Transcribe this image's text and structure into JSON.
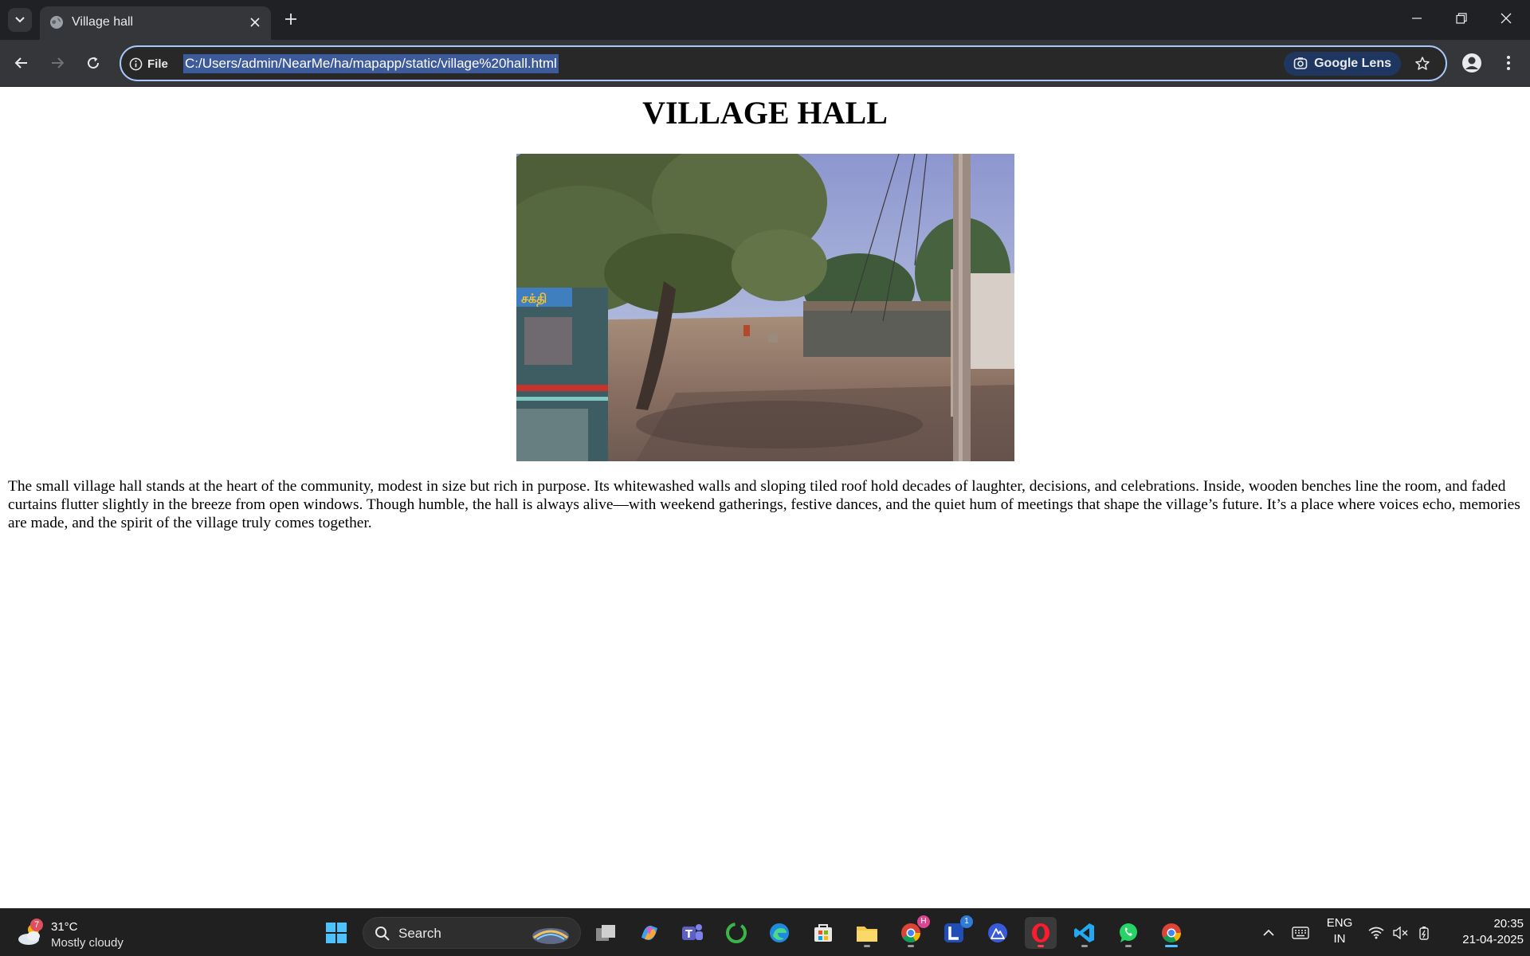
{
  "browser": {
    "tab_title": "Village hall",
    "site_info_label": "File",
    "url": "C:/Users/admin/NearMe/ha/mapapp/static/village%20hall.html",
    "lens_label": "Google Lens"
  },
  "page": {
    "title": "VILLAGE HALL",
    "image_overlay_text": "சக்தி",
    "description": "The small village hall stands at the heart of the community, modest in size but rich in purpose. Its whitewashed walls and sloping tiled roof hold decades of laughter, decisions, and celebrations. Inside, wooden benches line the room, and faded curtains flutter slightly in the breeze from open windows. Though humble, the hall is always alive—with weekend gatherings, festive dances, and the quiet hum of meetings that shape the village’s future. It’s a place where voices echo, memories are made, and the spirit of the village truly comes together."
  },
  "taskbar": {
    "weather_badge": "7",
    "weather_temp": "31°C",
    "weather_condition": "Mostly cloudy",
    "search_label": "Search",
    "chrome_badge": "H",
    "lens_app_badge": "1",
    "lang_primary": "ENG",
    "lang_secondary": "IN",
    "time": "20:35",
    "date": "21-04-2025"
  },
  "colors": {
    "tabbar": "#202124",
    "toolbar": "#35363a",
    "omnibox_border": "#a8c7fa",
    "url_selection": "#3d5a9a",
    "taskbar": "#202020",
    "active_indicator": "#4cc2ff"
  }
}
